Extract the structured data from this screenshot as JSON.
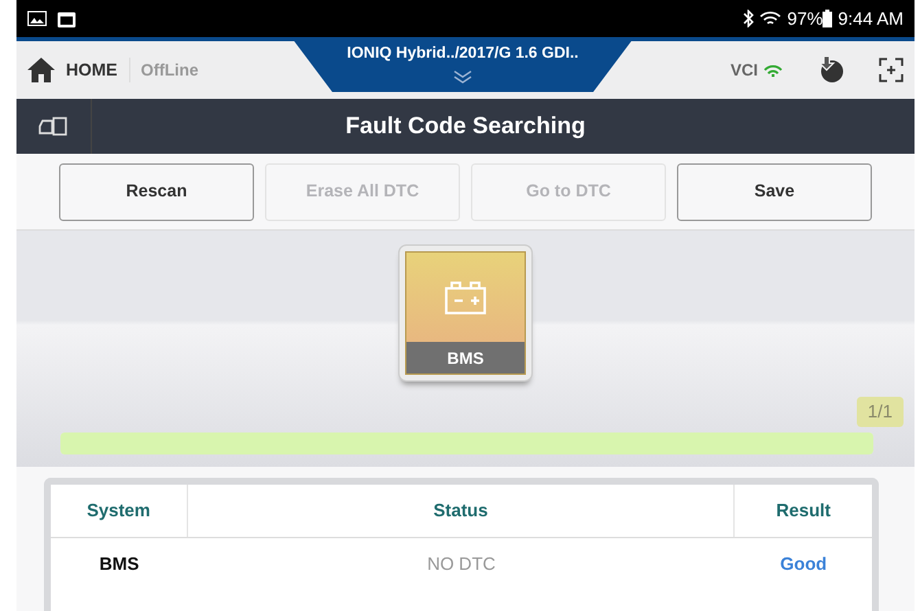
{
  "status_bar": {
    "battery": "97%",
    "time": "9:44 AM"
  },
  "header": {
    "home_label": "HOME",
    "mode": "OffLine",
    "vehicle": "IONIQ Hybrid../2017/G 1.6 GDI..",
    "vci": "VCI"
  },
  "title": "Fault Code Searching",
  "buttons": [
    {
      "label": "Rescan",
      "disabled": false
    },
    {
      "label": "Erase All DTC",
      "disabled": true
    },
    {
      "label": "Go to DTC",
      "disabled": true
    },
    {
      "label": "Save",
      "disabled": false
    }
  ],
  "module": {
    "label": "BMS"
  },
  "progress": {
    "counter": "1/1",
    "level": 1
  },
  "table": {
    "columns": [
      "System",
      "Status",
      "Result"
    ],
    "rows": [
      {
        "system": "BMS",
        "status": "NO DTC",
        "result": "Good"
      }
    ]
  }
}
